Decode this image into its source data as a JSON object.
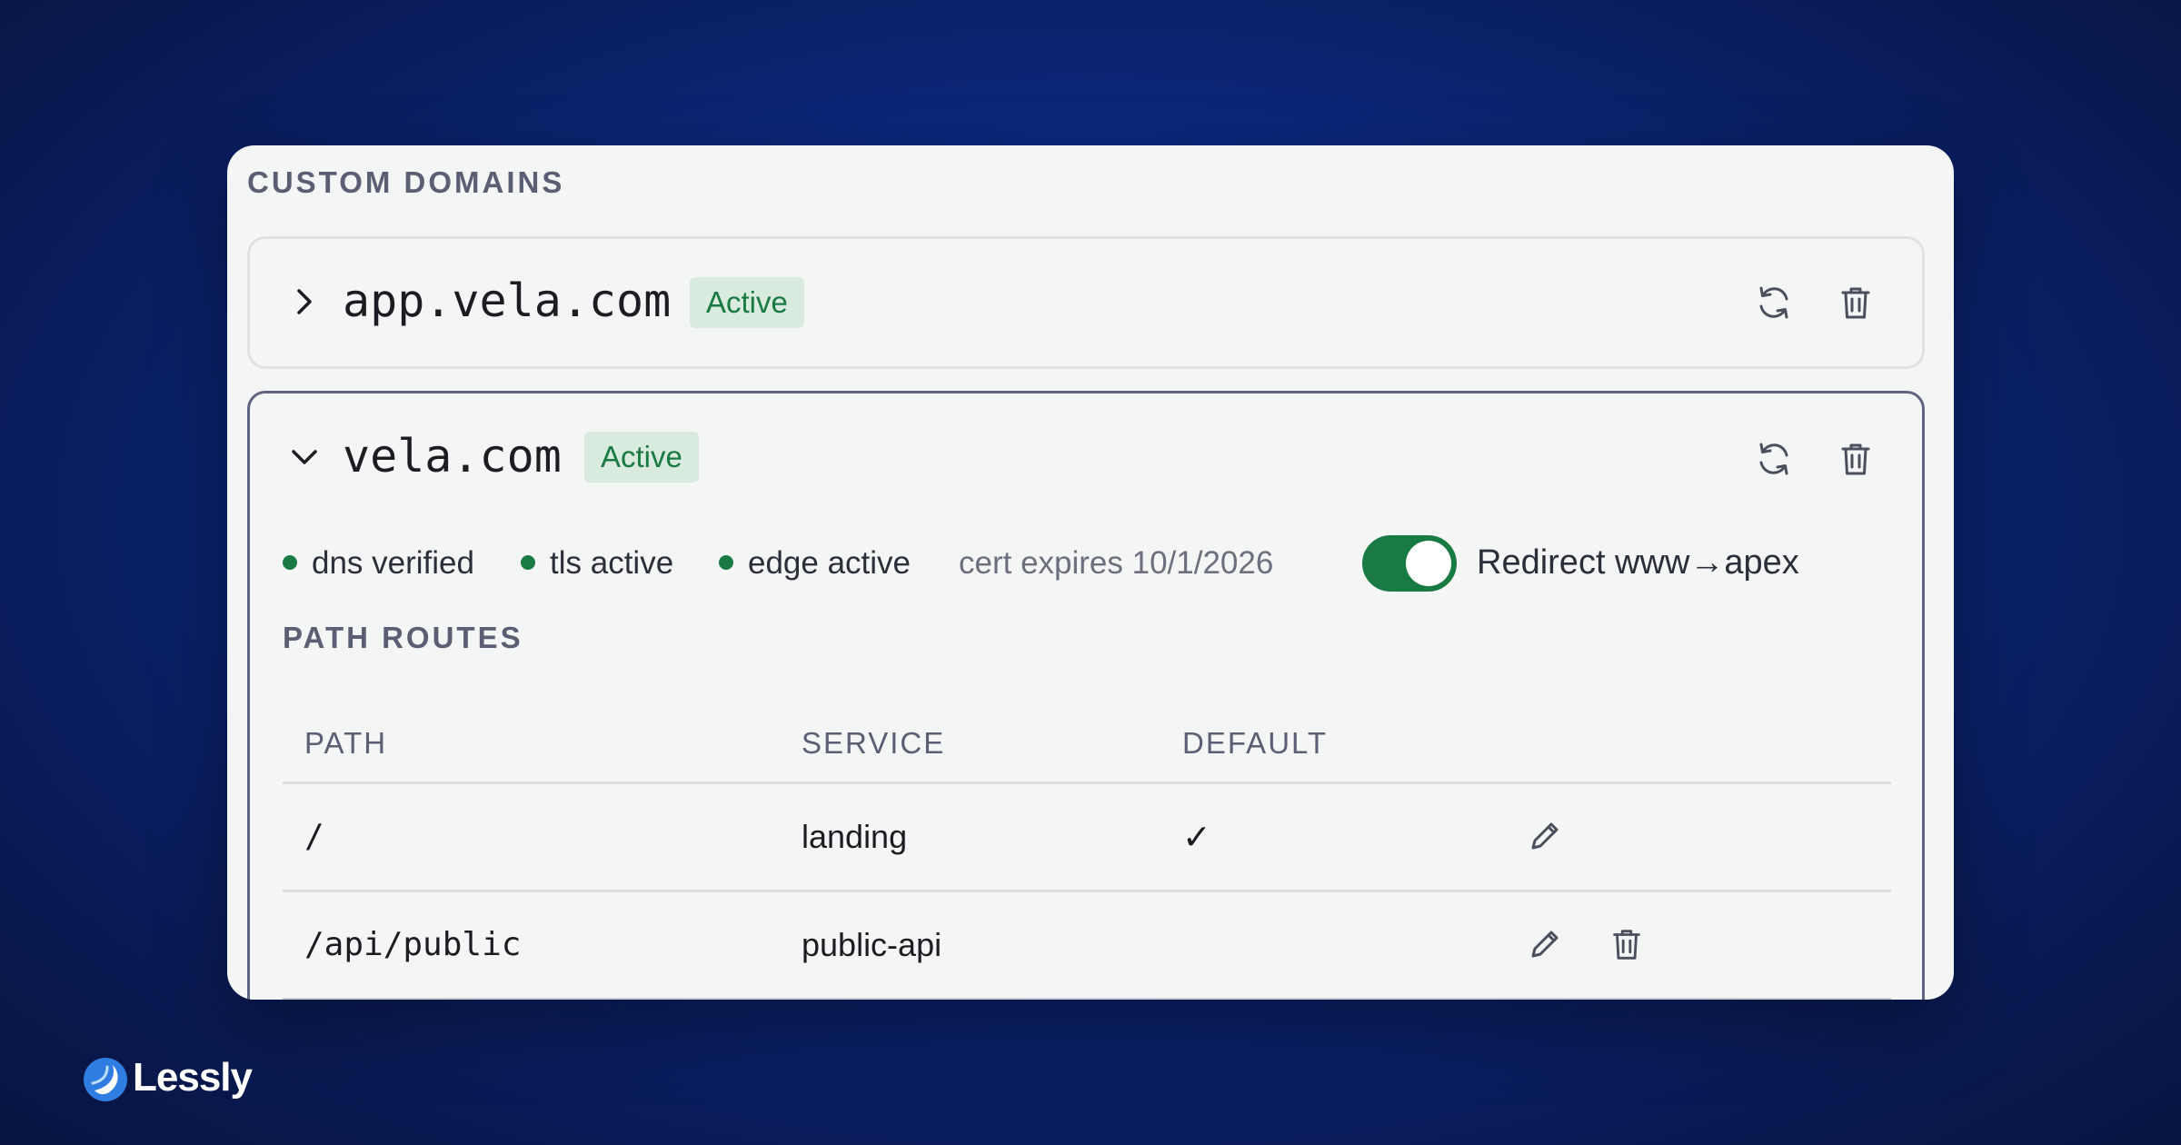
{
  "section_title": "CUSTOM DOMAINS",
  "domains": [
    {
      "name": "app.vela.com",
      "status": "Active",
      "expanded": false
    },
    {
      "name": "vela.com",
      "status": "Active",
      "expanded": true,
      "checks": [
        "dns verified",
        "tls active",
        "edge active"
      ],
      "cert": "cert expires 10/1/2026",
      "redirect": {
        "label": "Redirect www→apex",
        "enabled": true
      }
    }
  ],
  "path_routes": {
    "title": "PATH ROUTES",
    "columns": [
      "PATH",
      "SERVICE",
      "DEFAULT"
    ],
    "rows": [
      {
        "path": "/",
        "service": "landing",
        "default": "✓"
      },
      {
        "path": "/api/public",
        "service": "public-api",
        "default": ""
      }
    ]
  },
  "brand": {
    "name": "Lessly"
  },
  "colors": {
    "active_green": "#1a7a43",
    "badge_bg": "#d9ebdf",
    "background": "#0a2a82",
    "card": "#f4f6f5"
  },
  "icons": [
    "chevron-right-icon",
    "chevron-down-icon",
    "refresh-icon",
    "trash-icon",
    "pencil-icon",
    "check-icon",
    "lessly-logo-icon"
  ]
}
